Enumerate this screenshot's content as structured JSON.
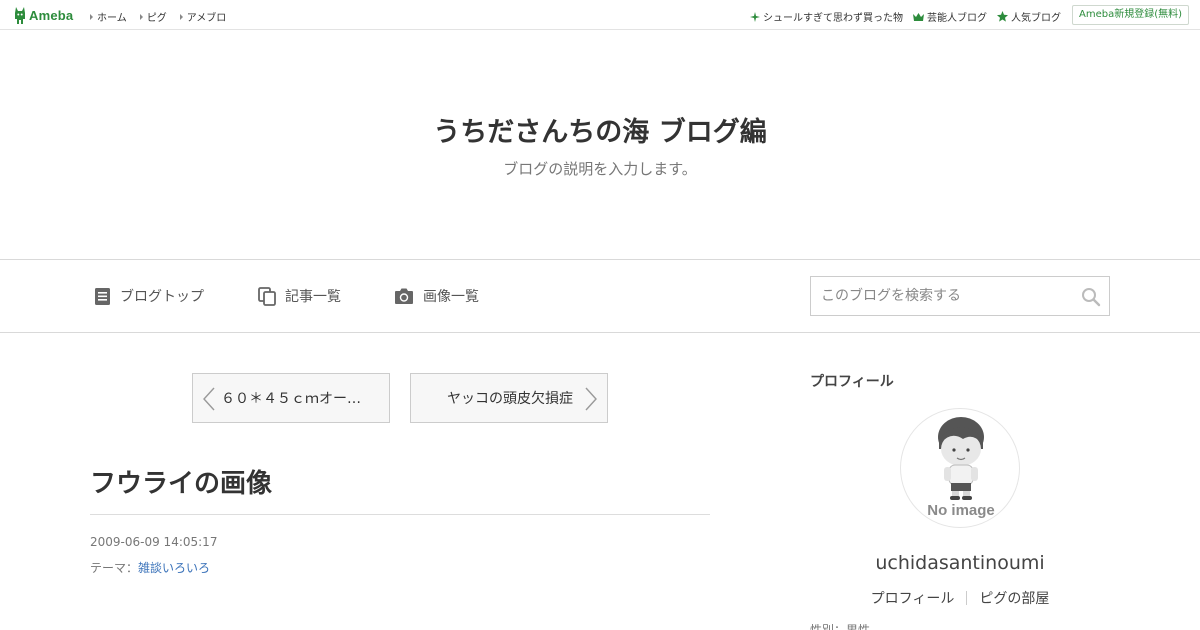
{
  "topbar": {
    "logo_text": "Ameba",
    "nav": [
      "ホーム",
      "ピグ",
      "アメブロ"
    ],
    "right_links": [
      {
        "label": "シュールすぎて思わず買った物",
        "icon": "sparkle-icon"
      },
      {
        "label": "芸能人ブログ",
        "icon": "crown-icon"
      },
      {
        "label": "人気ブログ",
        "icon": "star-icon"
      }
    ],
    "register_label": "Ameba新規登録(無料)",
    "brand_color": "#2d8c3c"
  },
  "header": {
    "title": "うちださんちの海 ブログ編",
    "description": "ブログの説明を入力します。"
  },
  "navbar": {
    "items": [
      {
        "label": "ブログトップ",
        "icon": "document-icon"
      },
      {
        "label": "記事一覧",
        "icon": "copy-icon"
      },
      {
        "label": "画像一覧",
        "icon": "camera-icon"
      }
    ],
    "search_placeholder": "このブログを検索する"
  },
  "pager": {
    "prev_label": "６０＊４５ｃｍオー…",
    "next_label": "ヤッコの頭皮欠損症"
  },
  "entry": {
    "title": "フウライの画像",
    "date": "2009-06-09 14:05:17",
    "theme_prefix": "テーマ：",
    "theme_link": "雑談いろいろ"
  },
  "sidebar": {
    "heading": "プロフィール",
    "avatar_text": "No image",
    "username": "uchidasantinoumi",
    "links": [
      "プロフィール",
      "ピグの部屋"
    ],
    "cut_text": "性別：男性"
  }
}
